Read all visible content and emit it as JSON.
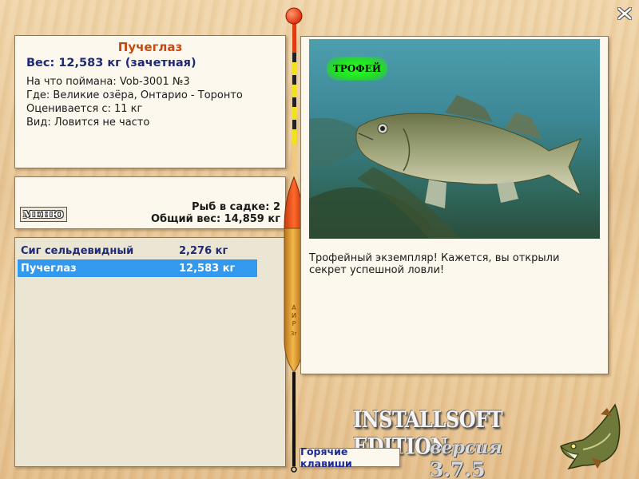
{
  "fish": {
    "name": "Пучеглаз",
    "weight_line": "Вес: 12,583 кг (зачетная)",
    "caught_on": "На что поймана: Vob-3001 №3",
    "location": "Где: Великие озёра, Онтарио - Торонто",
    "rated_from": "Оценивается с: 11 кг",
    "kind": "Вид: Ловится не часто"
  },
  "summary": {
    "menu_label": "МЕНЮ",
    "fish_in_keepnet": "Рыб в садке: 2",
    "total_weight": "Общий вес: 14,859 кг"
  },
  "catch_list": [
    {
      "name": "Сиг сельдевидный",
      "weight": "2,276 кг",
      "selected": false
    },
    {
      "name": "Пучеглаз",
      "weight": "12,583 кг",
      "selected": true
    }
  ],
  "photo": {
    "badge": "ТРОФЕЙ",
    "caption": "Трофейный экземпляр! Кажется, вы открыли секрет успешной ловли!"
  },
  "logo": {
    "title": "INSTALLSOFT EDITION",
    "version_word": "версия",
    "version_number": "3.7.5"
  },
  "hotkeys_label": "Горячие клавиши",
  "colors": {
    "fish_name": "#c44a12",
    "accent_blue": "#1d2a78",
    "selection": "#3399ee",
    "trophy_green": "#22e022",
    "wood": "#e9c99a"
  },
  "icons": {
    "close": "close-icon",
    "pike_logo": "pike-fish-icon",
    "float": "fishing-float-icon"
  }
}
